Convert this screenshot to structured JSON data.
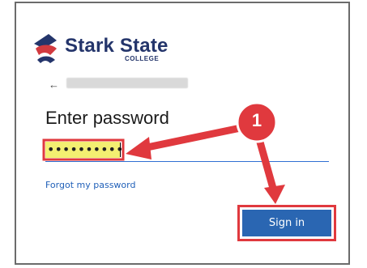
{
  "brand": {
    "name": "Stark State",
    "subname": "COLLEGE",
    "colors": {
      "navy": "#24356b",
      "red": "#d23a3f"
    }
  },
  "nav": {
    "back_icon": "arrow-left-icon",
    "back_glyph": "←"
  },
  "form": {
    "title": "Enter password",
    "password_value": "••••••••••",
    "forgot_label": "Forgot my password",
    "signin_label": "Sign in"
  },
  "annotation": {
    "step": "1",
    "color": "#e0393e"
  }
}
